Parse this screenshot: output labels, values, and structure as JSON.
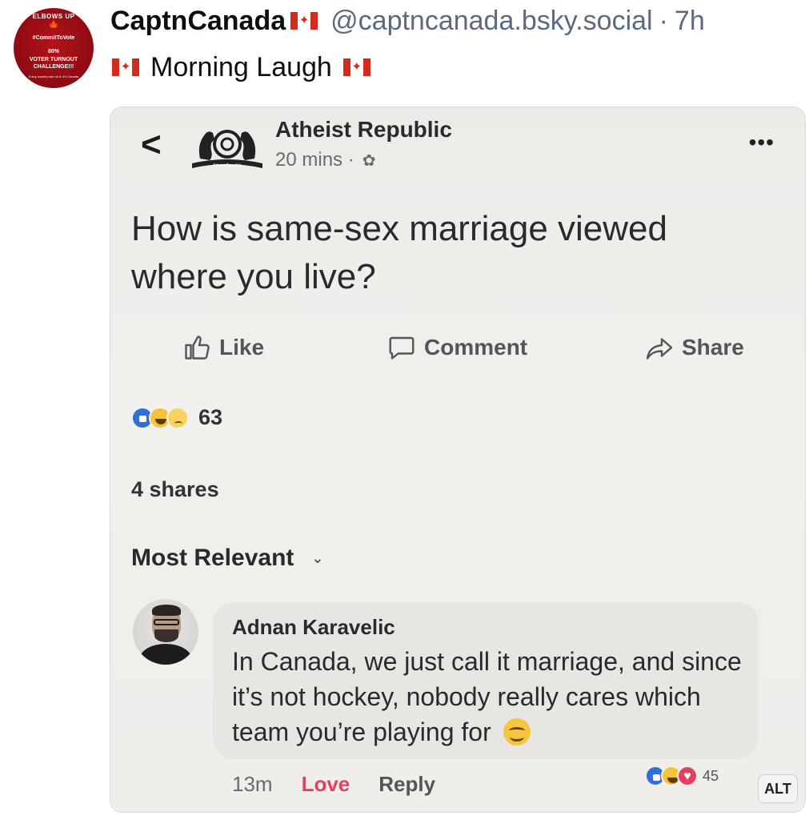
{
  "avatar": {
    "line1": "ELBOWS UP",
    "leaf": "🍁",
    "tag": "#CommitToVote",
    "pct": "80%",
    "line2": "VOTER TURNOUT",
    "line3": "CHALLENGE!!!",
    "fine_print": "If any country can do it, it's Canada"
  },
  "post": {
    "display_name": "CaptnCanada",
    "handle": "@captncanada.bsky.social",
    "separator": "·",
    "time": "7h",
    "text": "Morning Laugh",
    "flag_icon": "canada-flag-icon"
  },
  "embed": {
    "back_glyph": "<",
    "page_logo_text": "Atheist Republic",
    "page_name": "Atheist Republic",
    "page_time": "20 mins ·",
    "globe_glyph": "✿",
    "more_glyph": "•••",
    "question": "How is same-sex marriage viewed where you live?",
    "actions": {
      "like": "Like",
      "comment": "Comment",
      "share": "Share"
    },
    "reactions_count": "63",
    "shares": "4 shares",
    "sort_label": "Most Relevant",
    "sort_chevron": "⌄",
    "comment": {
      "author": "Adnan Karavelic",
      "text": "In Canada, we just call it marriage, and since it’s not hockey, nobody really cares which team you’re playing for",
      "age": "13m",
      "love": "Love",
      "reply": "Reply",
      "reactions_count": "45"
    }
  },
  "alt_badge": "ALT",
  "colors": {
    "text": "#0b0f14",
    "muted": "#5b6b7d",
    "flag_red": "#d52b1e",
    "avatar_red": "#b3121a",
    "love_pink": "#e4405f",
    "like_blue": "#2f6fd8"
  }
}
